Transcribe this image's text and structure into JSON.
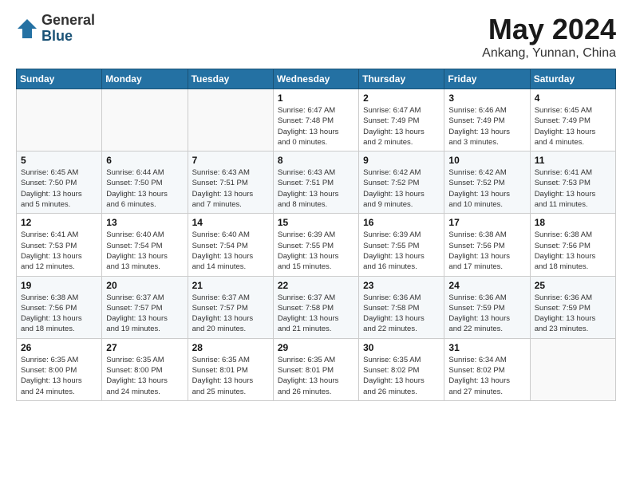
{
  "logo": {
    "general": "General",
    "blue": "Blue"
  },
  "title": "May 2024",
  "subtitle": "Ankang, Yunnan, China",
  "days_header": [
    "Sunday",
    "Monday",
    "Tuesday",
    "Wednesday",
    "Thursday",
    "Friday",
    "Saturday"
  ],
  "weeks": [
    [
      {
        "day": "",
        "info": ""
      },
      {
        "day": "",
        "info": ""
      },
      {
        "day": "",
        "info": ""
      },
      {
        "day": "1",
        "info": "Sunrise: 6:47 AM\nSunset: 7:48 PM\nDaylight: 13 hours\nand 0 minutes."
      },
      {
        "day": "2",
        "info": "Sunrise: 6:47 AM\nSunset: 7:49 PM\nDaylight: 13 hours\nand 2 minutes."
      },
      {
        "day": "3",
        "info": "Sunrise: 6:46 AM\nSunset: 7:49 PM\nDaylight: 13 hours\nand 3 minutes."
      },
      {
        "day": "4",
        "info": "Sunrise: 6:45 AM\nSunset: 7:49 PM\nDaylight: 13 hours\nand 4 minutes."
      }
    ],
    [
      {
        "day": "5",
        "info": "Sunrise: 6:45 AM\nSunset: 7:50 PM\nDaylight: 13 hours\nand 5 minutes."
      },
      {
        "day": "6",
        "info": "Sunrise: 6:44 AM\nSunset: 7:50 PM\nDaylight: 13 hours\nand 6 minutes."
      },
      {
        "day": "7",
        "info": "Sunrise: 6:43 AM\nSunset: 7:51 PM\nDaylight: 13 hours\nand 7 minutes."
      },
      {
        "day": "8",
        "info": "Sunrise: 6:43 AM\nSunset: 7:51 PM\nDaylight: 13 hours\nand 8 minutes."
      },
      {
        "day": "9",
        "info": "Sunrise: 6:42 AM\nSunset: 7:52 PM\nDaylight: 13 hours\nand 9 minutes."
      },
      {
        "day": "10",
        "info": "Sunrise: 6:42 AM\nSunset: 7:52 PM\nDaylight: 13 hours\nand 10 minutes."
      },
      {
        "day": "11",
        "info": "Sunrise: 6:41 AM\nSunset: 7:53 PM\nDaylight: 13 hours\nand 11 minutes."
      }
    ],
    [
      {
        "day": "12",
        "info": "Sunrise: 6:41 AM\nSunset: 7:53 PM\nDaylight: 13 hours\nand 12 minutes."
      },
      {
        "day": "13",
        "info": "Sunrise: 6:40 AM\nSunset: 7:54 PM\nDaylight: 13 hours\nand 13 minutes."
      },
      {
        "day": "14",
        "info": "Sunrise: 6:40 AM\nSunset: 7:54 PM\nDaylight: 13 hours\nand 14 minutes."
      },
      {
        "day": "15",
        "info": "Sunrise: 6:39 AM\nSunset: 7:55 PM\nDaylight: 13 hours\nand 15 minutes."
      },
      {
        "day": "16",
        "info": "Sunrise: 6:39 AM\nSunset: 7:55 PM\nDaylight: 13 hours\nand 16 minutes."
      },
      {
        "day": "17",
        "info": "Sunrise: 6:38 AM\nSunset: 7:56 PM\nDaylight: 13 hours\nand 17 minutes."
      },
      {
        "day": "18",
        "info": "Sunrise: 6:38 AM\nSunset: 7:56 PM\nDaylight: 13 hours\nand 18 minutes."
      }
    ],
    [
      {
        "day": "19",
        "info": "Sunrise: 6:38 AM\nSunset: 7:56 PM\nDaylight: 13 hours\nand 18 minutes."
      },
      {
        "day": "20",
        "info": "Sunrise: 6:37 AM\nSunset: 7:57 PM\nDaylight: 13 hours\nand 19 minutes."
      },
      {
        "day": "21",
        "info": "Sunrise: 6:37 AM\nSunset: 7:57 PM\nDaylight: 13 hours\nand 20 minutes."
      },
      {
        "day": "22",
        "info": "Sunrise: 6:37 AM\nSunset: 7:58 PM\nDaylight: 13 hours\nand 21 minutes."
      },
      {
        "day": "23",
        "info": "Sunrise: 6:36 AM\nSunset: 7:58 PM\nDaylight: 13 hours\nand 22 minutes."
      },
      {
        "day": "24",
        "info": "Sunrise: 6:36 AM\nSunset: 7:59 PM\nDaylight: 13 hours\nand 22 minutes."
      },
      {
        "day": "25",
        "info": "Sunrise: 6:36 AM\nSunset: 7:59 PM\nDaylight: 13 hours\nand 23 minutes."
      }
    ],
    [
      {
        "day": "26",
        "info": "Sunrise: 6:35 AM\nSunset: 8:00 PM\nDaylight: 13 hours\nand 24 minutes."
      },
      {
        "day": "27",
        "info": "Sunrise: 6:35 AM\nSunset: 8:00 PM\nDaylight: 13 hours\nand 24 minutes."
      },
      {
        "day": "28",
        "info": "Sunrise: 6:35 AM\nSunset: 8:01 PM\nDaylight: 13 hours\nand 25 minutes."
      },
      {
        "day": "29",
        "info": "Sunrise: 6:35 AM\nSunset: 8:01 PM\nDaylight: 13 hours\nand 26 minutes."
      },
      {
        "day": "30",
        "info": "Sunrise: 6:35 AM\nSunset: 8:02 PM\nDaylight: 13 hours\nand 26 minutes."
      },
      {
        "day": "31",
        "info": "Sunrise: 6:34 AM\nSunset: 8:02 PM\nDaylight: 13 hours\nand 27 minutes."
      },
      {
        "day": "",
        "info": ""
      }
    ]
  ]
}
